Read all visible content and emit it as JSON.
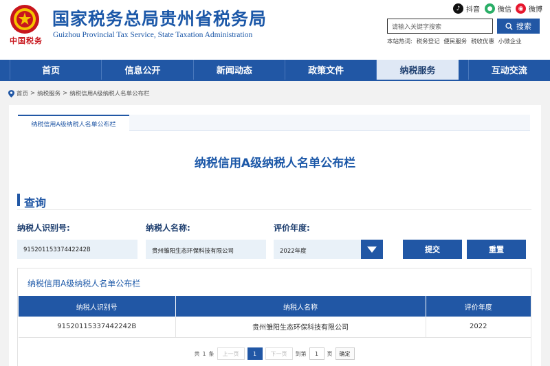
{
  "header": {
    "title": "国家税务总局贵州省税务局",
    "subtitle": "Guizhou Provincial Tax Service, State Taxation Administration",
    "brand_script": "中国税务",
    "social": [
      {
        "label": "抖音",
        "icon": "douyin-icon",
        "color": "#111111"
      },
      {
        "label": "微信",
        "icon": "wechat-icon",
        "color": "#2aae67"
      },
      {
        "label": "微博",
        "icon": "weibo-icon",
        "color": "#e6162d"
      }
    ],
    "search_placeholder": "请输入关键字搜索",
    "search_button": "搜索",
    "hot_label": "本站热词:",
    "hot_words": [
      "税务登记",
      "便民服务",
      "税收优惠",
      "小微企业"
    ]
  },
  "nav": {
    "items": [
      "首页",
      "信息公开",
      "新闻动态",
      "政策文件",
      "纳税服务",
      "互动交流"
    ],
    "active_index": 4
  },
  "breadcrumb": [
    "首页",
    "纳税服务",
    "纳税信用A级纳税人名单公布栏"
  ],
  "breadcrumb_sep": ">",
  "tab": "纳税信用A级纳税人名单公布栏",
  "page_title": "纳税信用A级纳税人名单公布栏",
  "query": {
    "section_title": "查询",
    "labels": {
      "id": "纳税人识别号:",
      "name": "纳税人名称:",
      "year": "评价年度:"
    },
    "values": {
      "id": "91520115337442242B",
      "name": "贵州雏阳生态环保科技有限公司",
      "year": "2022年度"
    },
    "submit": "提交",
    "reset": "重置"
  },
  "result": {
    "title": "纳税信用A级纳税人名单公布栏",
    "columns": [
      "纳税人识别号",
      "纳税人名称",
      "评价年度"
    ],
    "rows": [
      [
        "91520115337442242B",
        "贵州雏阳生态环保科技有限公司",
        "2022"
      ]
    ]
  },
  "pager": {
    "total_prefix": "共",
    "total": "1",
    "total_suffix": "条",
    "prev": "上一页",
    "current": "1",
    "next": "下一页",
    "goto_prefix": "到第",
    "goto_value": "1",
    "goto_suffix": "页",
    "confirm": "确定"
  },
  "colors": {
    "primary": "#2157a5",
    "title": "#1c58a8",
    "nav_active_bg": "#dfe8f5",
    "field_bg": "#e9f1f8"
  }
}
